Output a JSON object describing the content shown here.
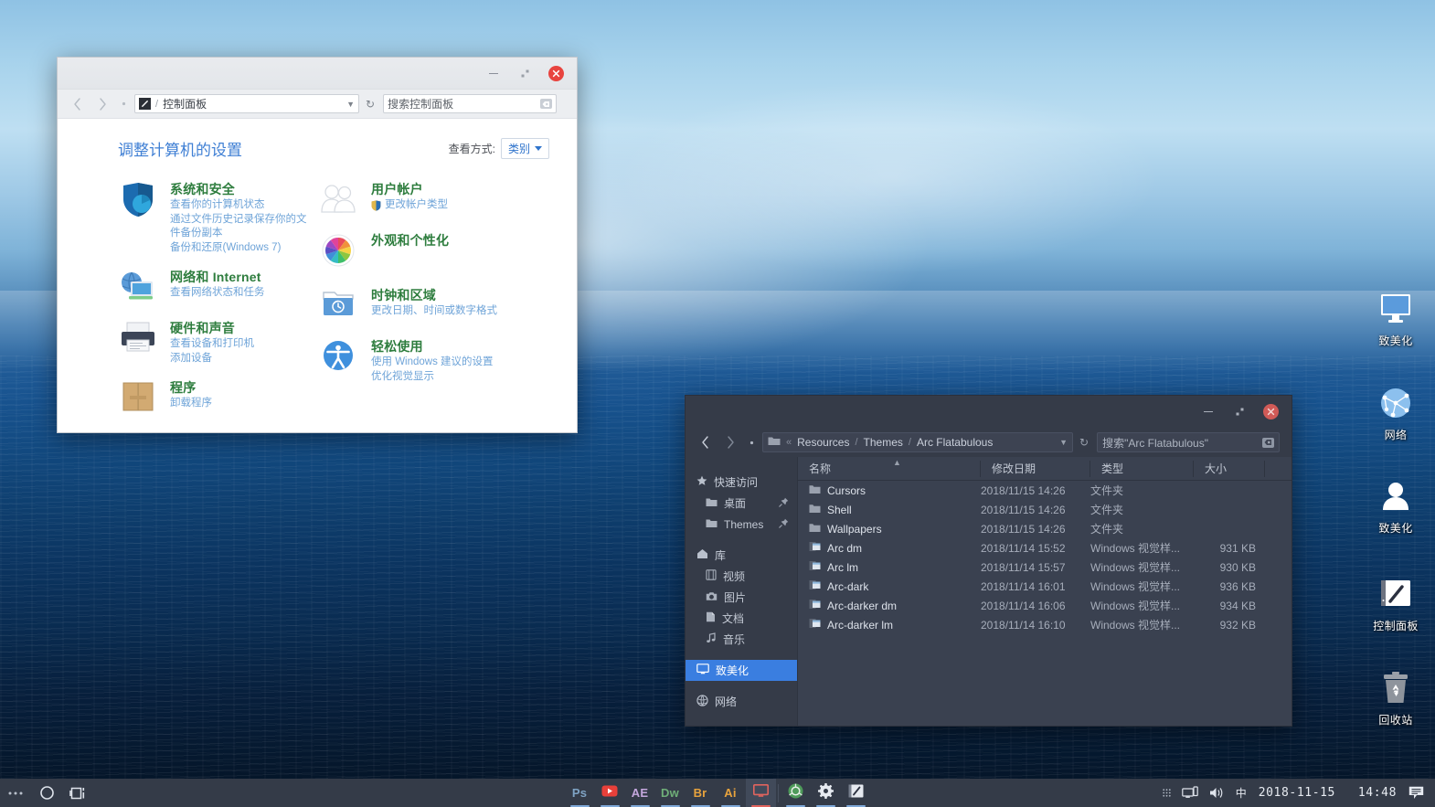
{
  "control_panel": {
    "window_title": "",
    "buttons": {
      "minimize": "minimize-button",
      "restore": "restore-button",
      "close": "close-button"
    },
    "nav": {
      "back": "back-button",
      "forward": "forward-button",
      "up": "up-button",
      "address_icon": "control-panel-icon",
      "address_separator": "/",
      "address_text": "控制面板",
      "dropdown": "chevron-down-icon",
      "refresh": "refresh-icon",
      "search_placeholder": "搜索控制面板",
      "search_clear": "clear-icon"
    },
    "heading": "调整计算机的设置",
    "view_by_label": "查看方式:",
    "view_by_value": "类别",
    "categories_left": [
      {
        "icon": "shield-security-icon",
        "title": "系统和安全",
        "links": [
          "查看你的计算机状态",
          "通过文件历史记录保存你的文件备份副本",
          "备份和还原(Windows 7)"
        ]
      },
      {
        "icon": "network-globe-icon",
        "title": "网络和 Internet",
        "links": [
          "查看网络状态和任务"
        ]
      },
      {
        "icon": "printer-icon",
        "title": "硬件和声音",
        "links": [
          "查看设备和打印机",
          "添加设备"
        ]
      },
      {
        "icon": "programs-box-icon",
        "title": "程序",
        "links": [
          "卸载程序"
        ]
      }
    ],
    "categories_right": [
      {
        "icon": "user-accounts-icon",
        "title": "用户帐户",
        "links": [
          "更改帐户类型"
        ],
        "shield_on_first_link": true
      },
      {
        "icon": "appearance-color-wheel-icon",
        "title": "外观和个性化",
        "links": []
      },
      {
        "icon": "clock-region-icon",
        "title": "时钟和区域",
        "links": [
          "更改日期、时间或数字格式"
        ]
      },
      {
        "icon": "ease-of-access-icon",
        "title": "轻松使用",
        "links": [
          "使用 Windows 建议的设置",
          "优化视觉显示"
        ]
      }
    ]
  },
  "explorer": {
    "buttons": {
      "minimize": "minimize-button",
      "restore": "restore-button",
      "close": "close-button"
    },
    "nav": {
      "back": "back-button",
      "forward": "forward-button",
      "up": "up-button",
      "folder_icon": "folder-icon",
      "overflow": "«",
      "crumbs": [
        "Resources",
        "Themes",
        "Arc Flatabulous"
      ],
      "crumb_separator": "/",
      "dropdown": "chevron-down-icon",
      "refresh": "refresh-icon",
      "search_placeholder": "搜索\"Arc Flatabulous\"",
      "search_clear": "clear-icon"
    },
    "sidebar": [
      {
        "label": "快速访问",
        "icon": "star-icon",
        "level": "top",
        "pinned": false,
        "selected": false
      },
      {
        "label": "桌面",
        "icon": "folder-icon",
        "level": "child",
        "pinned": true,
        "selected": false
      },
      {
        "label": "Themes",
        "icon": "folder-icon",
        "level": "child",
        "pinned": true,
        "selected": false
      },
      {
        "label": "库",
        "icon": "library-home-icon",
        "level": "top",
        "pinned": false,
        "selected": false
      },
      {
        "label": "视频",
        "icon": "video-icon",
        "level": "child",
        "pinned": false,
        "selected": false
      },
      {
        "label": "图片",
        "icon": "picture-camera-icon",
        "level": "child",
        "pinned": false,
        "selected": false
      },
      {
        "label": "文档",
        "icon": "document-icon",
        "level": "child",
        "pinned": false,
        "selected": false
      },
      {
        "label": "音乐",
        "icon": "music-note-icon",
        "level": "child",
        "pinned": false,
        "selected": false
      },
      {
        "label": "致美化",
        "icon": "this-pc-monitor-icon",
        "level": "top",
        "pinned": false,
        "selected": true
      },
      {
        "label": "网络",
        "icon": "network-globe-icon",
        "level": "top",
        "pinned": false,
        "selected": false
      }
    ],
    "columns": [
      "名称",
      "修改日期",
      "类型",
      "大小"
    ],
    "sort_indicator": "ascending",
    "files": [
      {
        "icon": "folder-icon",
        "name": "Cursors",
        "date": "2018/11/15 14:26",
        "type": "文件夹",
        "size": ""
      },
      {
        "icon": "folder-icon",
        "name": "Shell",
        "date": "2018/11/15 14:26",
        "type": "文件夹",
        "size": ""
      },
      {
        "icon": "folder-icon",
        "name": "Wallpapers",
        "date": "2018/11/15 14:26",
        "type": "文件夹",
        "size": ""
      },
      {
        "icon": "theme-file-icon",
        "name": "Arc dm",
        "date": "2018/11/14 15:52",
        "type": "Windows 视觉样...",
        "size": "931 KB"
      },
      {
        "icon": "theme-file-icon",
        "name": "Arc lm",
        "date": "2018/11/14 15:57",
        "type": "Windows 视觉样...",
        "size": "930 KB"
      },
      {
        "icon": "theme-file-icon",
        "name": "Arc-dark",
        "date": "2018/11/14 16:01",
        "type": "Windows 视觉样...",
        "size": "936 KB"
      },
      {
        "icon": "theme-file-icon",
        "name": "Arc-darker dm",
        "date": "2018/11/14 16:06",
        "type": "Windows 视觉样...",
        "size": "934 KB"
      },
      {
        "icon": "theme-file-icon",
        "name": "Arc-darker lm",
        "date": "2018/11/14 16:10",
        "type": "Windows 视觉样...",
        "size": "932 KB"
      }
    ]
  },
  "desktop_icons": [
    {
      "label": "致美化",
      "icon": "monitor-icon"
    },
    {
      "label": "网络",
      "icon": "network-globe-icon"
    },
    {
      "label": "致美化",
      "icon": "user-person-icon"
    },
    {
      "label": "控制面板",
      "icon": "control-panel-pen-icon"
    },
    {
      "label": "回收站",
      "icon": "recycle-bin-icon"
    }
  ],
  "taskbar": {
    "left_buttons": [
      {
        "name": "start-button",
        "icon": "ellipsis-icon",
        "label": "..."
      },
      {
        "name": "cortana-search-button",
        "icon": "circle-search-icon",
        "label": ""
      },
      {
        "name": "task-view-button",
        "icon": "task-view-icon",
        "label": ""
      }
    ],
    "apps": [
      {
        "name": "photoshop",
        "label": "Ps",
        "color": "#7fa3c4",
        "running": true,
        "active": false
      },
      {
        "name": "youtube",
        "label": "",
        "color": "#e8403a",
        "running": true,
        "active": false
      },
      {
        "name": "after-effects",
        "label": "AE",
        "color": "#c4a7dd",
        "running": true,
        "active": false
      },
      {
        "name": "dreamweaver",
        "label": "Dw",
        "color": "#6fae78",
        "running": true,
        "active": false
      },
      {
        "name": "bridge",
        "label": "Br",
        "color": "#e8a33d",
        "running": true,
        "active": false
      },
      {
        "name": "illustrator",
        "label": "Ai",
        "color": "#e8a33d",
        "running": true,
        "active": false
      },
      {
        "name": "file-explorer",
        "label": "",
        "color": "#e0645e",
        "running": true,
        "active": true
      },
      {
        "name": "chrome",
        "label": "",
        "color": "#4e9a5a",
        "running": true,
        "active": false
      },
      {
        "name": "settings",
        "label": "",
        "color": "#e6eaf0",
        "running": true,
        "active": false
      },
      {
        "name": "control-panel",
        "label": "",
        "color": "#e6eaf0",
        "running": true,
        "active": false
      }
    ],
    "tray": {
      "show_hidden": "chevron-grid-icon",
      "network": "network-icon",
      "volume": "volume-icon",
      "ime": "中",
      "date": "2018-11-15",
      "time": "14:48",
      "action_center": "action-center-icon"
    }
  }
}
